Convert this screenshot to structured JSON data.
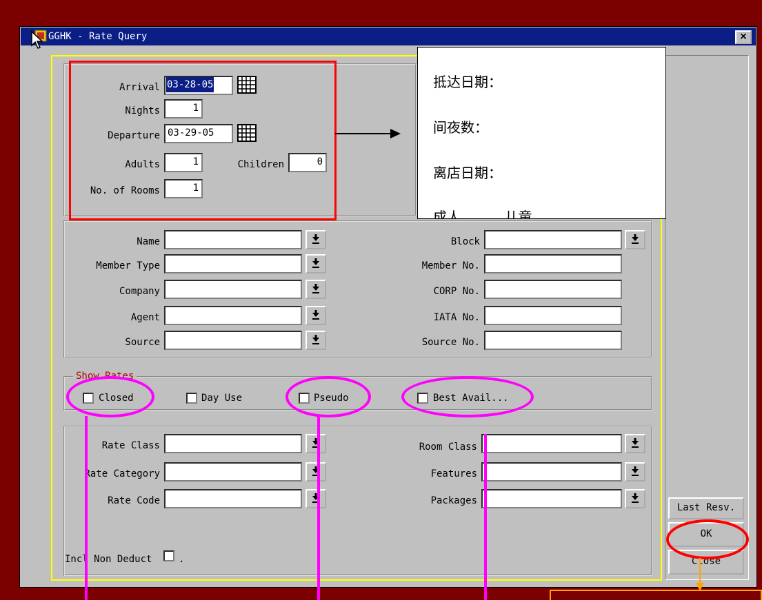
{
  "window": {
    "title": "GGHK - Rate Query",
    "close_glyph": "×"
  },
  "stay": {
    "arrival_label": "Arrival",
    "arrival_value": "03-28-05",
    "nights_label": "Nights",
    "nights_value": "1",
    "departure_label": "Departure",
    "departure_value": "03-29-05",
    "adults_label": "Adults",
    "adults_value": "1",
    "children_label": "Children",
    "children_value": "0",
    "rooms_label": "No. of Rooms",
    "rooms_value": "1"
  },
  "profile": {
    "name_label": "Name",
    "member_type_label": "Member Type",
    "company_label": "Company",
    "agent_label": "Agent",
    "source_label": "Source",
    "block_label": "Block",
    "member_no_label": "Member No.",
    "corp_no_label": "CORP No.",
    "iata_no_label": "IATA No.",
    "source_no_label": "Source No."
  },
  "show_rates": {
    "group_label": "Show Rates",
    "closed_label": "Closed",
    "day_use_label": "Day Use",
    "pseudo_label": "Pseudo",
    "best_avail_label": "Best Avail..."
  },
  "rates": {
    "rate_class_label": "Rate Class",
    "rate_category_label": "Rate Category",
    "rate_code_label": "Rate Code",
    "room_class_label": "Room Class",
    "features_label": "Features",
    "packages_label": "Packages",
    "incl_non_deduct_label": "Incl Non Deduct",
    "incl_suffix": "."
  },
  "buttons": {
    "last_resv": "Last Resv.",
    "ok": "OK",
    "close": "Close"
  },
  "annotation": {
    "line1": "抵达日期：",
    "line2": "间夜数：",
    "line3": "离店日期：",
    "line4": "成人          儿童"
  },
  "colors": {
    "background": "#7b0000",
    "titlebar": "#0a1e86",
    "highlight_red": "#ff0000",
    "highlight_magenta": "#ff00ff",
    "frame_yellow": "#ffff00"
  },
  "icons": [
    "app-icon",
    "calendar-icon",
    "dropdown-arrow-icon",
    "mouse-pointer-icon",
    "arrow-right-icon",
    "arrow-down-icon"
  ]
}
